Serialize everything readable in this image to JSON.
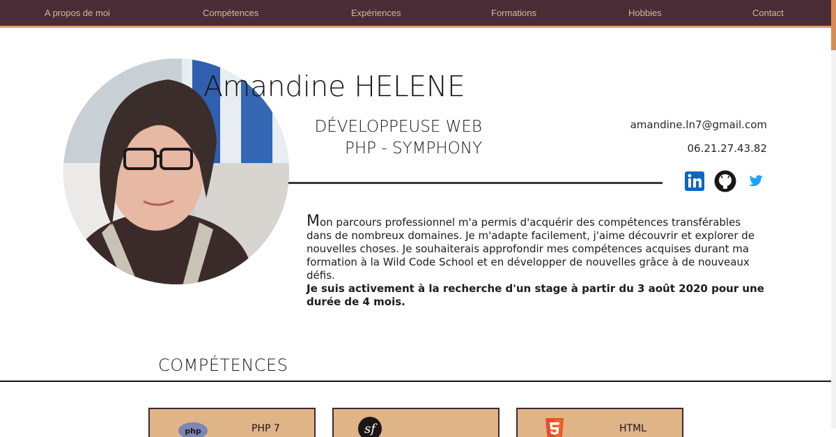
{
  "nav": {
    "items": [
      "A propos de moi",
      "Compétences",
      "Expériences",
      "Formations",
      "Hobbies",
      "Contact"
    ]
  },
  "profile": {
    "name": "Amandine HELENE",
    "title_line1": "DÉVELOPPEUSE WEB",
    "title_line2": "PHP - SYMPHONY",
    "email": "amandine.ln7@gmail.com",
    "phone": "06.21.27.43.82"
  },
  "social": {
    "linkedin_icon": "linkedin-icon",
    "github_icon": "github-icon",
    "twitter_icon": "twitter-icon"
  },
  "bio": {
    "drop_letter": "M",
    "text": "on parcours professionnel m'a permis d'acquérir des compétences transférables dans de nombreux domaines. Je m'adapte facilement, j'aime découvrir et explorer de nouvelles choses. Je souhaiterais approfondir mes compétences acquises durant ma formation à la Wild Code School et en développer de nouvelles grâce à de nouveaux défis.",
    "highlight": "Je suis activement à la recherche d'un stage à partir du 3 août 2020 pour une durée de 4 mois."
  },
  "skills": {
    "section_title": "COMPÉTENCES",
    "cards": [
      {
        "icon": "php-icon",
        "label": "PHP 7"
      },
      {
        "icon": "symfony-icon",
        "label": ""
      },
      {
        "icon": "html5-icon",
        "label": "HTML"
      }
    ]
  },
  "colors": {
    "nav_bg": "#4a2c36",
    "nav_text": "#d9b79a",
    "accent": "#d9a27a",
    "card_bg": "#dfb487"
  }
}
